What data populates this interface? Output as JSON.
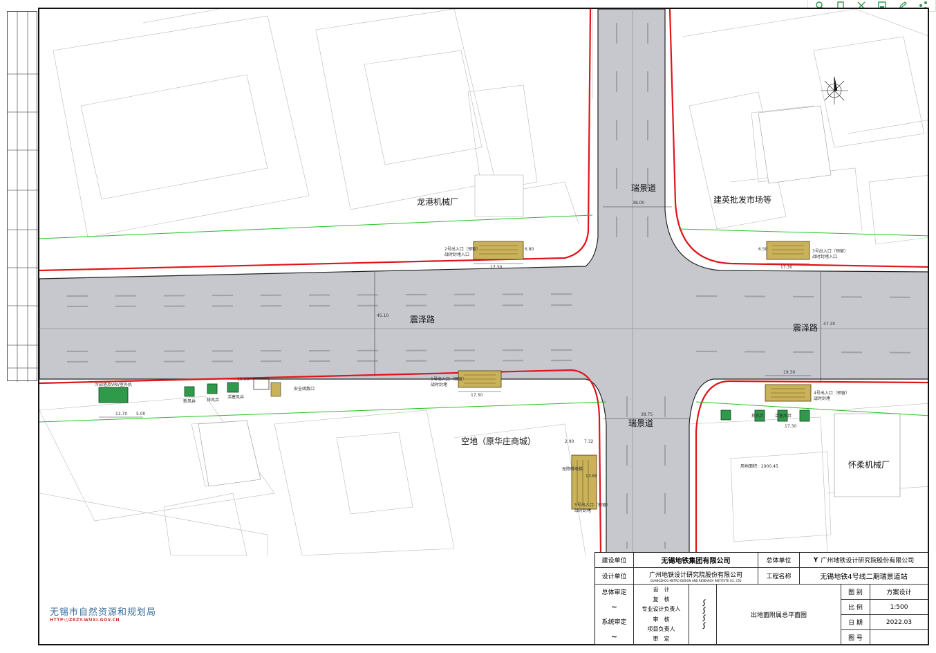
{
  "toolbar": {
    "buttons": [
      {
        "name": "zoom-icon"
      },
      {
        "name": "copy-icon"
      },
      {
        "name": "expand-icon"
      },
      {
        "name": "save-icon"
      },
      {
        "name": "edit-icon"
      },
      {
        "name": "share-icon"
      }
    ]
  },
  "map": {
    "roads": {
      "north_south": "瑞景道",
      "east_west": "震泽路"
    },
    "labels": {
      "longgang_factory": "龙港机械厂",
      "jianying_market": "建英批发市场等",
      "vacant_lot": "空地（原华庄商城）",
      "huairou_factory": "怀柔机械厂",
      "entry2": "2号出入口（预留）",
      "entry2_sub": "战时封堵入口",
      "entry3": "3号出入口（预留）",
      "entry3_sub": "战时封堵入口",
      "entry1": "1号出入口（预留）",
      "entry1_sub": "战时封堵",
      "entry4": "4号出入口（预留）",
      "entry4_sub": "战时封堵",
      "entry5": "5号出入口（预留）",
      "entry5_sub": "战时封堵",
      "cooling": "冷却塔及VRV室外机",
      "fresh_air": "新风井",
      "exhaust": "排风井",
      "piston": "活塞风井",
      "safety_exit": "安全疏散口",
      "accessible_lift": "无障碍电梯",
      "area_note": "用地面积：2900.45"
    },
    "dims": {
      "d1": "38.00",
      "d2": "38.75",
      "d3": "17.30",
      "d4": "17.30",
      "d5": "17.30",
      "d6": "19.30",
      "d7": "11.70",
      "d8": "5.00",
      "d9": "47.30",
      "d10": "45.10",
      "d11": "7.32",
      "d12": "2.90",
      "d13": "6.80",
      "d14": "6.50",
      "d15": "10.00",
      "d16": "13.80",
      "d17": "17.30"
    }
  },
  "bureau": {
    "name": "无锡市自然资源和规划局",
    "url": "HTTP://ZRZY.WUXI.GOV.CN"
  },
  "title_block": {
    "build_unit_label": "建设单位",
    "build_unit": "无锡地铁集团有限公司",
    "general_unit_label": "总体单位",
    "general_unit": "广州地铁设计研究院股份有限公司",
    "design_unit_label": "设计单位",
    "design_unit": "广州地铁设计研究院股份有限公司",
    "en_name": "GUANGZHOU METRO DESIGN AND RESEARCH INSTITUTE CO., LTD",
    "project_label": "工程名称",
    "project": "无锡地铁4号线二期瑞景道站",
    "drawing_name": "出地面附属总平面图",
    "roles": [
      "设　计",
      "复　核",
      "专业设计负责人",
      "审　核",
      "项目负责人",
      "审　定"
    ],
    "left_roles": [
      "总体审定",
      "系统审定"
    ],
    "meta": [
      {
        "k": "图 别",
        "v": "方案设计"
      },
      {
        "k": "比 例",
        "v": "1:500"
      },
      {
        "k": "日 期",
        "v": "2022.03"
      },
      {
        "k": "图 号",
        "v": ""
      }
    ]
  },
  "colors": {
    "road": "#c6c8ce",
    "redline": "#e0141b",
    "greenline": "#21c421",
    "station": "#c9b25a",
    "green_box": "#2e9a4a"
  }
}
